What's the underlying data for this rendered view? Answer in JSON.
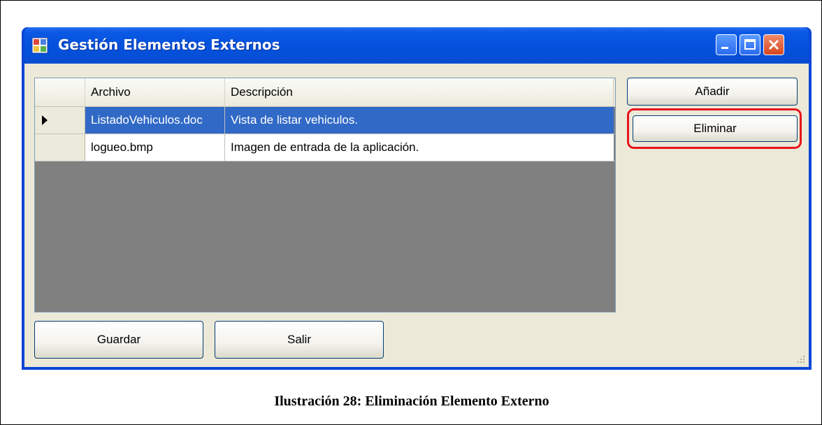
{
  "window": {
    "title": "Gestión Elementos Externos"
  },
  "grid": {
    "columns": [
      "Archivo",
      "Descripción"
    ],
    "rows": [
      {
        "file": "ListadoVehiculos.doc",
        "description": "Vista de listar vehiculos.",
        "selected": true
      },
      {
        "file": "logueo.bmp",
        "description": "Imagen de entrada de la aplicación.",
        "selected": false
      }
    ]
  },
  "buttons": {
    "add": "Añadir",
    "delete": "Eliminar",
    "save": "Guardar",
    "exit": "Salir"
  },
  "caption": "Ilustración 28: Eliminación Elemento Externo",
  "colors": {
    "titlebar": "#0653de",
    "selection": "#3169c6",
    "highlight": "#e8141c",
    "client_bg": "#ece9d8",
    "grid_bg": "#808080"
  },
  "icons": {
    "app": "window-grid-icon",
    "minimize": "minimize-icon",
    "maximize": "maximize-icon",
    "close": "close-icon",
    "row_indicator": "current-row-arrow-icon",
    "resize": "resize-grip-icon"
  }
}
